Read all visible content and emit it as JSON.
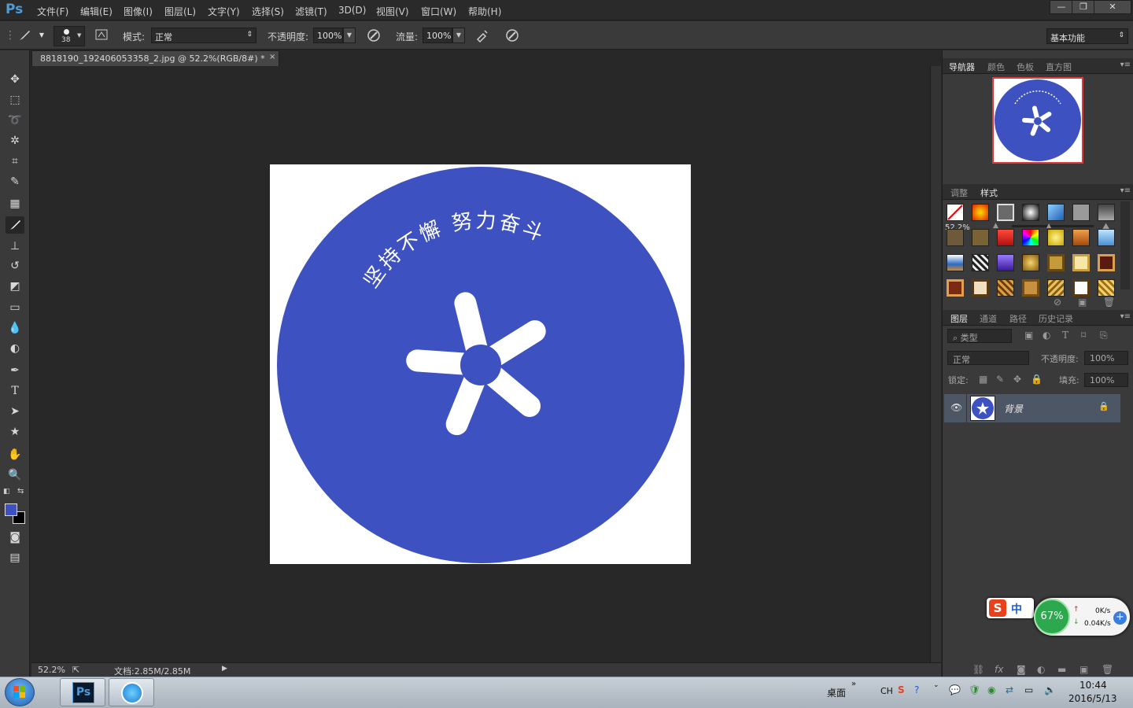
{
  "app": {
    "logo": "Ps",
    "menu": [
      "文件(F)",
      "编辑(E)",
      "图像(I)",
      "图层(L)",
      "文字(Y)",
      "选择(S)",
      "滤镜(T)",
      "3D(D)",
      "视图(V)",
      "窗口(W)",
      "帮助(H)"
    ],
    "window_buttons": [
      "—",
      "❐",
      "✕"
    ]
  },
  "options": {
    "brush_size": "38",
    "mode_label": "模式:",
    "mode_value": "正常",
    "opacity_label": "不透明度:",
    "opacity_value": "100%",
    "flow_label": "流量:",
    "flow_value": "100%",
    "workspace": "基本功能"
  },
  "document": {
    "tab_title": "8818190_192406053358_2.jpg @ 52.2%(RGB/8#) *",
    "close": "×",
    "image_text": "坚持不懈 努力奋斗",
    "logo_color": "#3d51c1"
  },
  "status": {
    "zoom": "52.2%",
    "doc_size": "文档:2.85M/2.85M"
  },
  "navigator": {
    "tabs": [
      "导航器",
      "颜色",
      "色板",
      "直方图"
    ],
    "zoom": "52.2%"
  },
  "styles": {
    "tabs": [
      "调整",
      "样式"
    ]
  },
  "layers": {
    "tabs": [
      "图层",
      "通道",
      "路径",
      "历史记录"
    ],
    "filter_kind": "类型",
    "blend_mode": "正常",
    "opacity_label": "不透明度:",
    "opacity_value": "100%",
    "lock_label": "锁定:",
    "fill_label": "填充:",
    "fill_value": "100%",
    "items": [
      {
        "name": "背景",
        "visible": true,
        "locked": true
      }
    ]
  },
  "widgets": {
    "ime": "中",
    "net_percent": "67%",
    "net_up": "0K/s",
    "net_down": "0.04K/s"
  },
  "taskbar": {
    "desktop_label": "桌面",
    "lang": "CH",
    "time": "10:44",
    "date": "2016/5/13"
  }
}
